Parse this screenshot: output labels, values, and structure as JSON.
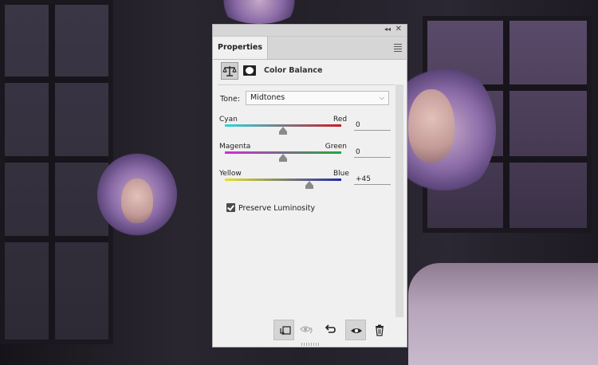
{
  "panel": {
    "tab_label": "Properties",
    "adjustment_title": "Color Balance",
    "tone": {
      "label": "Tone:",
      "value": "Midtones"
    },
    "sliders": [
      {
        "left": "Cyan",
        "right": "Red",
        "value": "0",
        "position": 0.5
      },
      {
        "left": "Magenta",
        "right": "Green",
        "value": "0",
        "position": 0.5
      },
      {
        "left": "Yellow",
        "right": "Blue",
        "value": "+45",
        "position": 0.725
      }
    ],
    "preserve_luminosity": {
      "label": "Preserve Luminosity",
      "checked": true
    }
  },
  "icons": {
    "collapse": "double-chevron-left-icon",
    "close": "close-icon",
    "panel_menu": "hamburger-menu-icon",
    "adjustment": "balance-scale-icon",
    "mask": "layer-mask-icon",
    "clip": "clip-to-layer-icon",
    "view_previous": "view-previous-state-icon",
    "reset": "reset-icon",
    "visibility": "eye-icon",
    "delete": "trash-icon"
  },
  "colors": {
    "panel_bg": "#f0f0f0",
    "cyan_red": [
      "#2fd4e0",
      "#c81d25"
    ],
    "magenta_green": [
      "#d22ad8",
      "#1faa3a"
    ],
    "yellow_blue": [
      "#e8e02a",
      "#1f2aa8"
    ]
  }
}
